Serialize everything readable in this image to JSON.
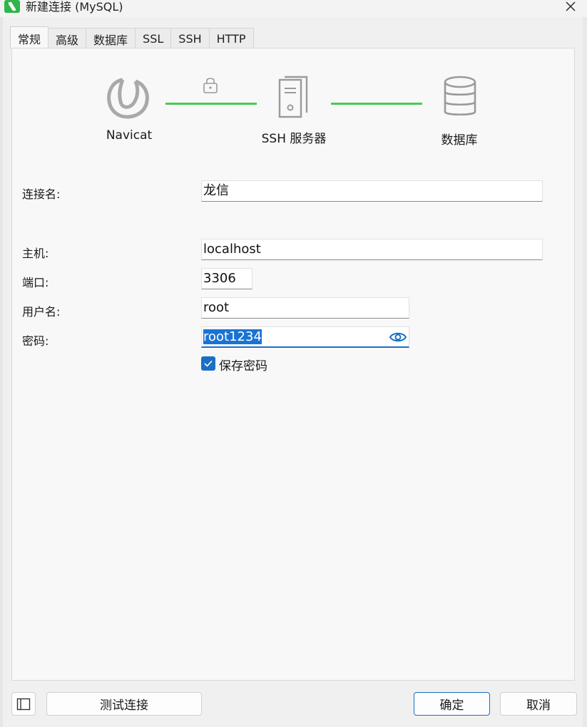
{
  "window": {
    "title": "新建连接 (MySQL)"
  },
  "tabs": [
    {
      "label": "常规",
      "active": true
    },
    {
      "label": "高级"
    },
    {
      "label": "数据库"
    },
    {
      "label": "SSL"
    },
    {
      "label": "SSH"
    },
    {
      "label": "HTTP"
    }
  ],
  "diagram": {
    "client_label": "Navicat",
    "ssh_label": "SSH 服务器",
    "db_label": "数据库",
    "line_color": "#4cc94f"
  },
  "form": {
    "connection_name": {
      "label": "连接名:",
      "value": "龙信"
    },
    "host": {
      "label": "主机:",
      "value": "localhost"
    },
    "port": {
      "label": "端口:",
      "value": "3306"
    },
    "username": {
      "label": "用户名:",
      "value": "root"
    },
    "password": {
      "label": "密码:",
      "value": "root1234"
    },
    "save_password": {
      "label": "保存密码",
      "checked": true
    }
  },
  "buttons": {
    "test": "测试连接",
    "ok": "确定",
    "cancel": "取消"
  },
  "colors": {
    "accent": "#1a6fc4",
    "selection": "#1a73d4",
    "brand": "#2fb54a"
  }
}
